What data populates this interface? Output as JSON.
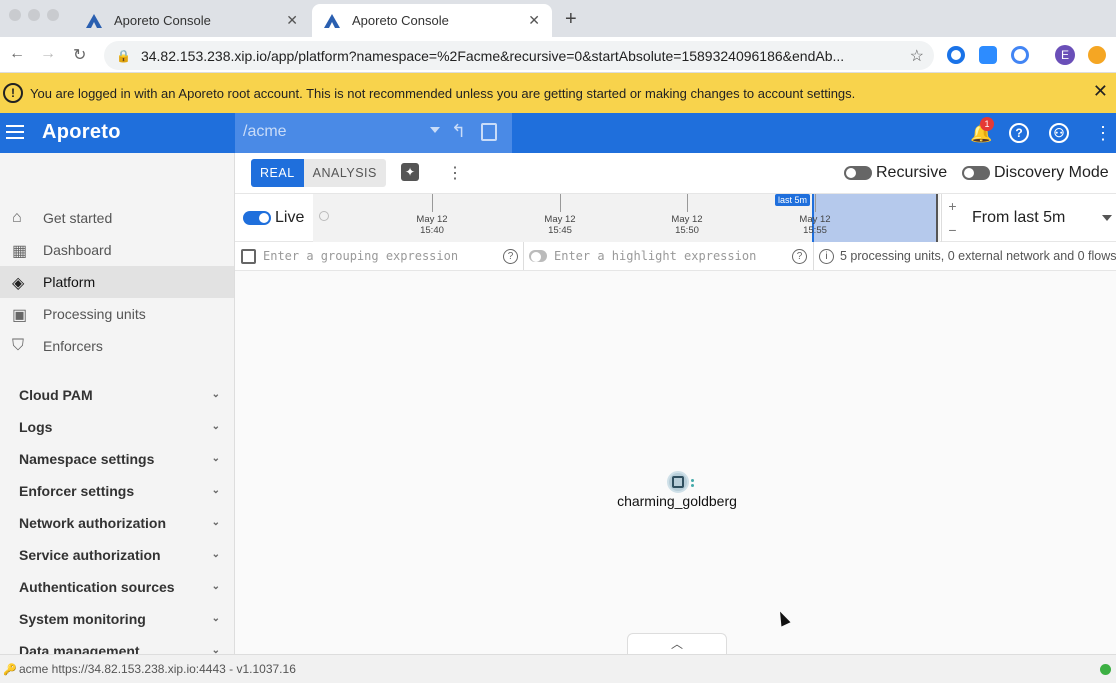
{
  "browser": {
    "tabs": [
      {
        "title": "Aporeto Console",
        "active": false
      },
      {
        "title": "Aporeto Console",
        "active": true
      }
    ],
    "new_tab": "+",
    "url": "34.82.153.238.xip.io/app/platform?namespace=%2Facme&recursive=0&startAbsolute=1589324096186&endAb...",
    "profile_initial": "E"
  },
  "banner": {
    "text": "You are logged in with an Aporeto root account. This is not recommended unless you are getting started or making changes to account settings.",
    "warn": "!",
    "close": "✕"
  },
  "header": {
    "brand": "Aporeto",
    "namespace": "/acme",
    "notification_count": "1",
    "help": "?",
    "account": "⚇",
    "color": "#1f6fdc"
  },
  "sidebar": {
    "items": [
      {
        "label": "Get started",
        "icon": "home-icon"
      },
      {
        "label": "Dashboard",
        "icon": "dashboard-icon"
      },
      {
        "label": "Platform",
        "icon": "layers-icon",
        "active": true
      },
      {
        "label": "Processing units",
        "icon": "chip-icon"
      },
      {
        "label": "Enforcers",
        "icon": "shield-icon"
      }
    ],
    "groups": [
      "Cloud PAM",
      "Logs",
      "Namespace settings",
      "Enforcer settings",
      "Network authorization",
      "Service authorization",
      "Authentication sources",
      "System monitoring",
      "Data management"
    ]
  },
  "toolbar": {
    "real_label": "REAL",
    "analysis_label": "ANALYSIS",
    "recursive_label": "Recursive",
    "discovery_label": "Discovery Mode"
  },
  "timeline": {
    "live_label": "Live",
    "ticks": [
      {
        "date": "May 12",
        "time": "15:40"
      },
      {
        "date": "May 12",
        "time": "15:45"
      },
      {
        "date": "May 12",
        "time": "15:50"
      },
      {
        "date": "May 12",
        "time": "15:55"
      }
    ],
    "range_tag": "last 5m",
    "zoom_in": "+",
    "zoom_out": "−",
    "range_select": "From last 5m"
  },
  "expressions": {
    "grouping_placeholder": "Enter a grouping expression",
    "highlight_placeholder": "Enter a highlight expression",
    "info": "5 processing units, 0 external network and 0 flows"
  },
  "canvas": {
    "node_label": "charming_goldberg",
    "drawer_handle": "︿"
  },
  "statusbar": {
    "text": "acme https://34.82.153.238.xip.io:4443 - v1.1037.16",
    "status_color": "#3cb043"
  }
}
